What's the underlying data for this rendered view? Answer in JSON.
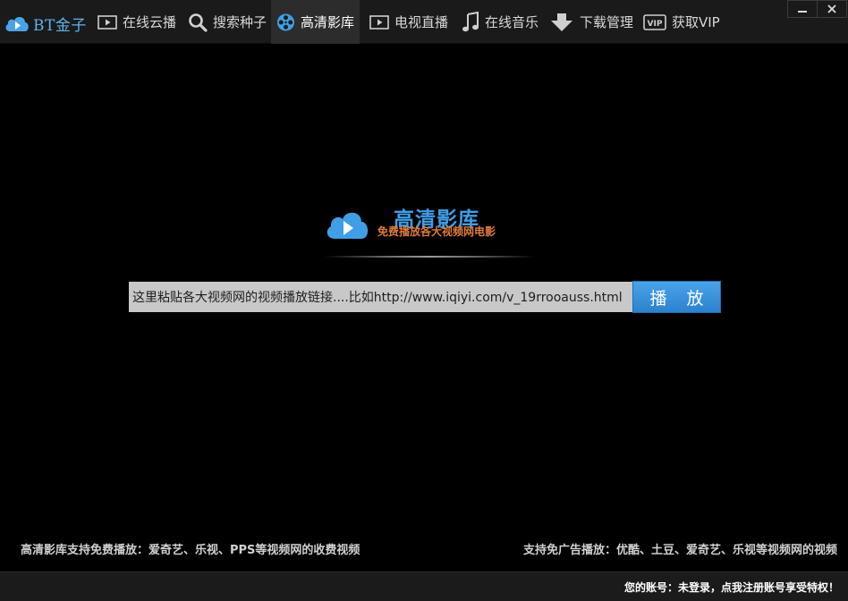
{
  "brand": {
    "name": "BT金子",
    "icon": "cloud-play-icon"
  },
  "nav": [
    {
      "label": "在线云播",
      "icon": "play-icon",
      "active": false
    },
    {
      "label": "搜索种子",
      "icon": "search-icon",
      "active": false
    },
    {
      "label": "高清影库",
      "icon": "film-reel-icon",
      "active": true
    },
    {
      "label": "电视直播",
      "icon": "play-icon",
      "active": false
    },
    {
      "label": "在线音乐",
      "icon": "music-note-icon",
      "active": false
    },
    {
      "label": "下载管理",
      "icon": "download-arrow-icon",
      "active": false
    },
    {
      "label": "获取VIP",
      "icon": "vip-badge-icon",
      "active": false
    }
  ],
  "window_controls": {
    "minimize": "minimize-icon",
    "close": "close-icon"
  },
  "logo": {
    "title": "高清影库",
    "subtitle": "免费播放各大视频网电影"
  },
  "search": {
    "value": "这里粘贴各大视频网的视频播放链接....比如http://www.iqiyi.com/v_19rrooauss.html",
    "button_label": "播 放"
  },
  "notes": {
    "left": "高清影库支持免费播放：爱奇艺、乐视、PPS等视频网的收费视频",
    "right": "支持免广告播放：优酷、土豆、爱奇艺、乐视等视频网的视频"
  },
  "status": {
    "account": "您的账号：未登录，点我注册账号享受特权！"
  },
  "colors": {
    "accent": "#3f9ee6",
    "button": "#2b82cf",
    "background": "#000000",
    "toolbar": "#1a1a1a"
  }
}
